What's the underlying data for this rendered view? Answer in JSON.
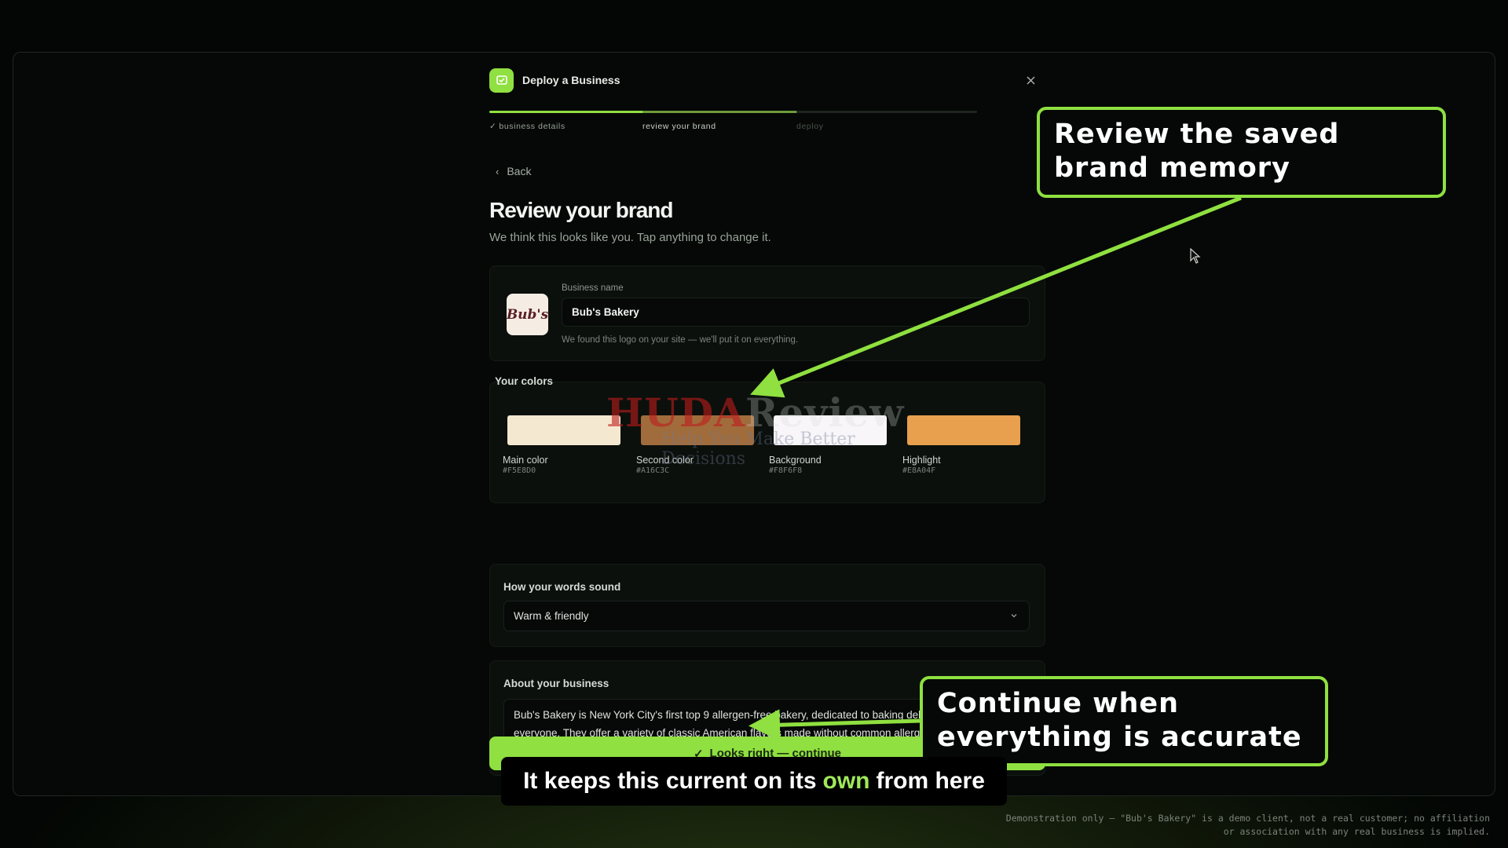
{
  "header": {
    "title": "Deploy a Business",
    "close_icon": "close-icon",
    "app_icon": "bolt-icon"
  },
  "steps": [
    {
      "label": "business details",
      "state": "done"
    },
    {
      "label": "review your brand",
      "state": "active"
    },
    {
      "label": "deploy",
      "state": "upcoming"
    }
  ],
  "back_label": "Back",
  "page": {
    "title": "Review your brand",
    "subtitle": "We think this looks like you. Tap anything to change it."
  },
  "business": {
    "name_label": "Business name",
    "name_value": "Bub's Bakery",
    "logo_text": "Bub's",
    "hint": "We found this logo on your site — we'll put it on everything."
  },
  "colors": {
    "title": "Your colors",
    "swatches": [
      {
        "name": "Main color",
        "hex": "#F5E8D0",
        "color": "#F5E8D0"
      },
      {
        "name": "Second color",
        "hex": "#A16C3C",
        "color": "#A16C3C"
      },
      {
        "name": "Background",
        "hex": "#F8F6F8",
        "color": "#F8F6F8"
      },
      {
        "name": "Highlight",
        "hex": "#E8A04F",
        "color": "#E8A04F"
      }
    ]
  },
  "tone": {
    "title": "How your words sound",
    "value": "Warm & friendly"
  },
  "about": {
    "title": "About your business",
    "text": "Bub's Bakery is New York City's first top 9 allergen-free bakery, dedicated to baking delicious treats for everyone. They offer a variety of classic American flavors made without common allergens, ensuring that people with dietary restrictions can enjoy iconic tastes."
  },
  "continue_label": "Looks right — continue",
  "callouts": {
    "one": "Review the saved brand memory",
    "two": "Continue when everything is accurate"
  },
  "caption": {
    "before": "It keeps this current on its",
    "highlight": "own",
    "after": "from here"
  },
  "watermark": {
    "brand_red": "HUDA",
    "brand_gray": "Review",
    "tagline": "Help You Make Better Decisions"
  },
  "disclaimer": "Demonstration only — \"Bub's Bakery\" is a demo client, not a real customer; no affiliation or association with any real business is implied.",
  "accent_color": "#8FE040"
}
